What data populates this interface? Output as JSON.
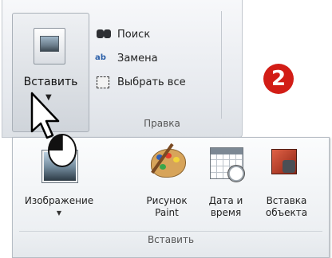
{
  "edit_group": {
    "paste_label": "Вставить",
    "paste_arrow": "▼",
    "find_label": "Поиск",
    "replace_label": "Замена",
    "replace_glyph": "ab",
    "select_all_label": "Выбрать все",
    "group_label": "Правка"
  },
  "step_badge": "2",
  "insert_group": {
    "group_label": "Вставить",
    "tools": [
      {
        "line1": "Изображение",
        "line2": "",
        "has_dropdown": true,
        "arrow": "▼",
        "icon": "image-icon"
      },
      {
        "line1": "Рисунок",
        "line2": "Paint",
        "has_dropdown": false,
        "icon": "paint-palette-icon"
      },
      {
        "line1": "Дата и",
        "line2": "время",
        "has_dropdown": false,
        "icon": "calendar-clock-icon"
      },
      {
        "line1": "Вставка",
        "line2": "объекта",
        "has_dropdown": false,
        "icon": "insert-object-icon"
      }
    ]
  },
  "colors": {
    "badge": "#d21d16",
    "ribbon_bg": "#e6e9ee",
    "panel_bg": "#eceff2"
  }
}
